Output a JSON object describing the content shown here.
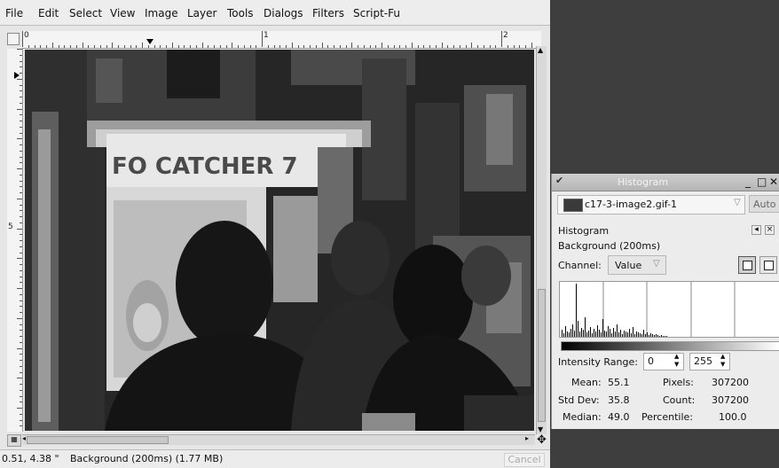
{
  "menu": {
    "items": [
      "File",
      "Edit",
      "Select",
      "View",
      "Image",
      "Layer",
      "Tools",
      "Dialogs",
      "Filters",
      "Script-Fu"
    ],
    "underline": [
      "F",
      "E",
      "S",
      "V",
      "I",
      "L",
      "T",
      "D",
      "r",
      "S"
    ]
  },
  "rulers": {
    "h_labels": [
      "0",
      "1",
      "2"
    ],
    "v_labels": [
      "5"
    ]
  },
  "statusbar": {
    "coords": "0.51, 4.38 \"",
    "info": "Background (200ms) (1.77 MB)",
    "cancel": "Cancel"
  },
  "canvas": {
    "sign_text": "FO CATCHER 7"
  },
  "histogram_dialog": {
    "title": "Histogram",
    "image_menu": "c17-3-image2.gif-1",
    "auto_button": "Auto",
    "panel_title": "Histogram",
    "layer_name": "Background (200ms)",
    "channel_label": "Channel:",
    "channel_value": "Value",
    "intensity_label": "Intensity Range:",
    "range_min": "0",
    "range_max": "255",
    "stats": {
      "mean_label": "Mean:",
      "mean": "55.1",
      "stddev_label": "Std Dev:",
      "stddev": "35.8",
      "median_label": "Median:",
      "median": "49.0",
      "pixels_label": "Pixels:",
      "pixels": "307200",
      "count_label": "Count:",
      "count": "307200",
      "percentile_label": "Percentile:",
      "percentile": "100.0"
    }
  }
}
